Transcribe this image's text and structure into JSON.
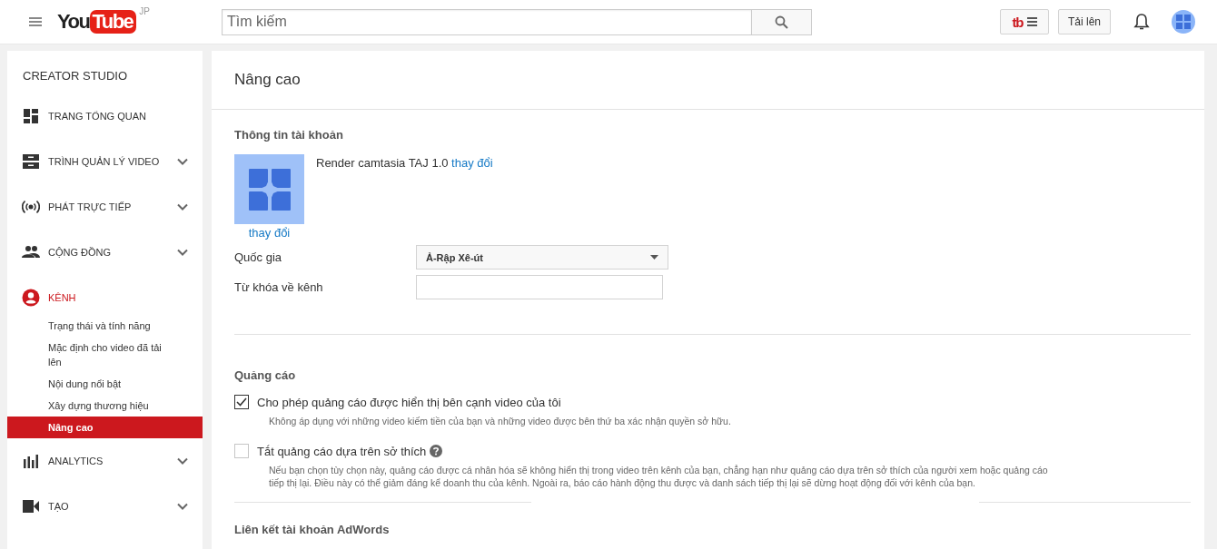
{
  "header": {
    "logo": {
      "left": "You",
      "right": "Tube",
      "region": "JP"
    },
    "search": {
      "placeholder": "Tìm kiếm"
    },
    "extension_button": {
      "text": "tb"
    },
    "upload_button": "Tải lên"
  },
  "sidebar": {
    "title": "CREATOR STUDIO",
    "items": [
      {
        "label": "TRANG TỔNG QUAN",
        "collapsible": false,
        "selected": false
      },
      {
        "label": "TRÌNH QUẢN LÝ VIDEO",
        "collapsible": true,
        "selected": false
      },
      {
        "label": "PHÁT TRỰC TIẾP",
        "collapsible": true,
        "selected": false
      },
      {
        "label": "CỘNG ĐỒNG",
        "collapsible": true,
        "selected": false
      },
      {
        "label": "KÊNH",
        "collapsible": false,
        "selected": true,
        "children": [
          {
            "label": "Trạng thái và tính năng",
            "selected": false
          },
          {
            "label": "Mặc định cho video đã tải lên",
            "selected": false
          },
          {
            "label": "Nội dung nổi bật",
            "selected": false
          },
          {
            "label": "Xây dựng thương hiệu",
            "selected": false
          },
          {
            "label": "Nâng cao",
            "selected": true
          }
        ]
      },
      {
        "label": "ANALYTICS",
        "collapsible": true,
        "selected": false
      },
      {
        "label": "TẠO",
        "collapsible": true,
        "selected": false
      }
    ]
  },
  "main": {
    "title": "Nâng cao",
    "account": {
      "heading": "Thông tin tài khoản",
      "name": "Render camtasia TAJ 1.0",
      "name_link": "thay đổi",
      "avatar_link": "thay đổi",
      "fields": [
        {
          "kind": "select",
          "label": "Quốc gia",
          "value": "Ả-Rập Xê-út"
        },
        {
          "kind": "text",
          "label": "Từ khóa về kênh"
        }
      ]
    },
    "ads": {
      "heading": "Quảng cáo",
      "options": [
        {
          "label": "Cho phép quảng cáo được hiển thị bên cạnh video của tôi",
          "checked": true,
          "help": false,
          "note": "Không áp dụng với những video kiếm tiền của bạn và những video được bên thứ ba xác nhận quyền sở hữu."
        },
        {
          "label": "Tắt quảng cáo dựa trên sở thích",
          "checked": false,
          "help": true,
          "note": "Nếu bạn chọn tùy chọn này, quảng cáo được cá nhân hóa sẽ không hiển thị trong video trên kênh của bạn, chẳng hạn như quảng cáo dựa trên sở thích của người xem hoặc quảng cáo tiếp thị lại. Điều này có thể giảm đáng kể doanh thu của kênh. Ngoài ra, báo cáo hành động thu được và danh sách tiếp thị lại sẽ dừng hoạt động đối với kênh của bạn."
        }
      ]
    },
    "next_heading": "Liên kết tài khoản AdWords"
  }
}
